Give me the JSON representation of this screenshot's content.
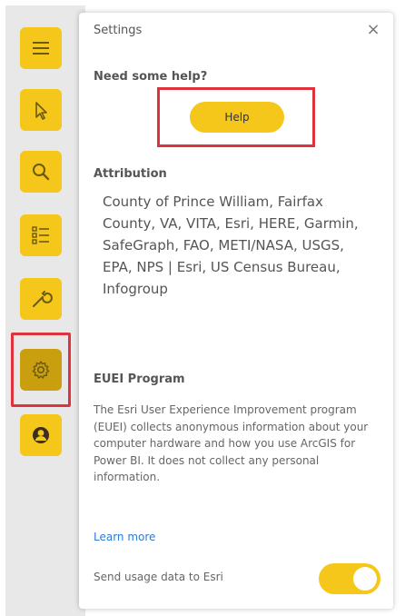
{
  "rail": {
    "tools": [
      {
        "name": "menu-icon",
        "active": false
      },
      {
        "name": "select-pointer-icon",
        "active": false
      },
      {
        "name": "search-icon",
        "active": false
      },
      {
        "name": "layers-list-icon",
        "active": false
      },
      {
        "name": "wrench-icon",
        "active": false
      },
      {
        "name": "gear-icon",
        "active": true
      },
      {
        "name": "user-icon",
        "active": false
      }
    ]
  },
  "panel": {
    "title": "Settings",
    "close_label": "×",
    "help_heading": "Need some help?",
    "help_button": "Help",
    "attribution_heading": "Attribution",
    "attribution_text": "County of Prince William, Fairfax County, VA, VITA, Esri, HERE, Garmin, SafeGraph, FAO, METI/NASA, USGS, EPA, NPS | Esri, US Census Bureau, Infogroup",
    "euei_heading": "EUEI Program",
    "euei_text": "The Esri User Experience Improvement program (EUEI) collects anonymous information about your computer hardware and how you use ArcGIS for Power BI. It does not collect any personal information.",
    "learn_more": "Learn more",
    "usage_label": "Send usage data to Esri",
    "usage_enabled": true
  },
  "colors": {
    "accent": "#f5c71a",
    "accent_active": "#c99f10",
    "highlight": "#e0313e",
    "link": "#2b7bd6"
  }
}
